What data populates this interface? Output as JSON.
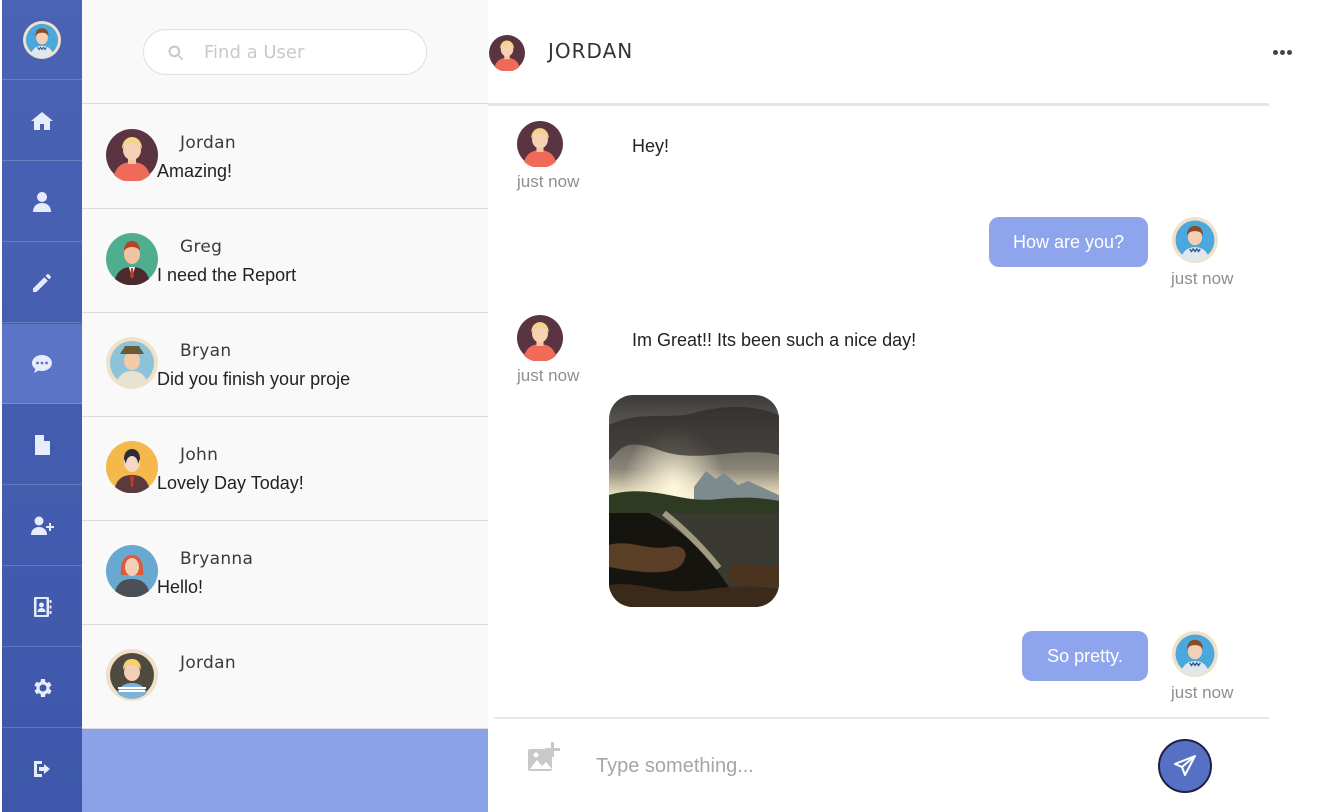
{
  "colors": {
    "rail": "#4a63b5",
    "rail_active": "#5b74c6",
    "accent_bubble": "#8ea4ec",
    "list_footer": "#8ca2e8"
  },
  "rail": {
    "items": [
      {
        "icon": "user-avatar"
      },
      {
        "icon": "home-icon"
      },
      {
        "icon": "user-icon"
      },
      {
        "icon": "pencil-icon"
      },
      {
        "icon": "chat-bubble-icon",
        "active": true
      },
      {
        "icon": "document-icon"
      },
      {
        "icon": "add-user-icon"
      },
      {
        "icon": "contacts-book-icon"
      },
      {
        "icon": "gear-icon"
      },
      {
        "icon": "logout-icon"
      }
    ]
  },
  "search": {
    "placeholder": "Find a User"
  },
  "conversations": [
    {
      "name": "Jordan",
      "preview": "Amazing!"
    },
    {
      "name": "Greg",
      "preview": "I need the Report"
    },
    {
      "name": "Bryan",
      "preview": "Did you finish your proje"
    },
    {
      "name": "John",
      "preview": "Lovely Day Today!"
    },
    {
      "name": "Bryanna",
      "preview": "Hello!"
    },
    {
      "name": "Jordan",
      "preview": ""
    }
  ],
  "chat": {
    "title": "JORDAN",
    "messages": [
      {
        "from": "them",
        "text": "Hey!",
        "time": "just now"
      },
      {
        "from": "me",
        "text": "How are you?",
        "time": "just now"
      },
      {
        "from": "them",
        "text": "Im Great!! Its been such a nice day!",
        "time": "just now"
      },
      {
        "from": "me",
        "text": "So pretty.",
        "time": "just now"
      }
    ],
    "composer_placeholder": "Type something..."
  }
}
